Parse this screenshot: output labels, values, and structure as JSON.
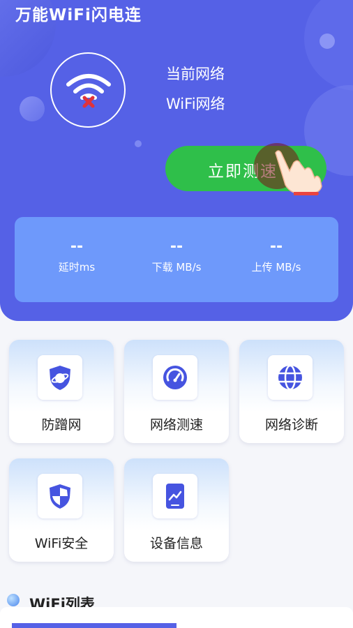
{
  "header": {
    "app_title": "万能WiFi闪电连",
    "network_status_label": "当前网络",
    "network_name": "WiFi网络",
    "speed_test_button": "立即测速"
  },
  "stats": [
    {
      "value": "--",
      "label": "延时ms"
    },
    {
      "value": "--",
      "label": "下载 MB/s"
    },
    {
      "value": "--",
      "label": "上传 MB/s"
    }
  ],
  "features": [
    {
      "label": "防蹭网",
      "icon": "shield-planet-icon"
    },
    {
      "label": "网络测速",
      "icon": "speedometer-icon"
    },
    {
      "label": "网络诊断",
      "icon": "globe-icon"
    },
    {
      "label": "WiFi安全",
      "icon": "security-shield-icon"
    },
    {
      "label": "设备信息",
      "icon": "device-chart-icon"
    }
  ],
  "wifi_list": {
    "title": "WiFi列表"
  },
  "colors": {
    "primary": "#5561e6",
    "accent_green": "#2fbf4a",
    "stats_panel": "#6e99fb",
    "icon_blue": "#4654e0",
    "disconnect_red": "#e0323a"
  }
}
